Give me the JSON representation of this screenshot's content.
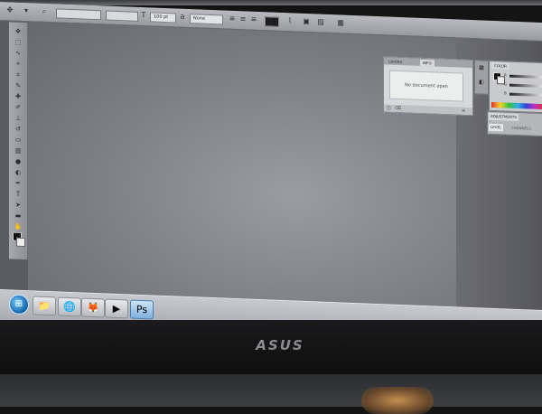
{
  "options_bar": {
    "zoom_value": "100 pt",
    "mode_value": "None"
  },
  "history_panel": {
    "tabs": [
      "LAYERS",
      "INFO"
    ],
    "message": "No document open"
  },
  "right_dock": {
    "color_tab": "COLOR",
    "adjust_tabs": [
      "ADJUSTMENTS",
      "LEVEL",
      "CHANNELS"
    ]
  },
  "taskbar": {
    "items": [
      "windows-explorer",
      "internet-explorer",
      "firefox",
      "media-player",
      "photoshop"
    ]
  },
  "brand": {
    "logo_text": "ASUS"
  }
}
